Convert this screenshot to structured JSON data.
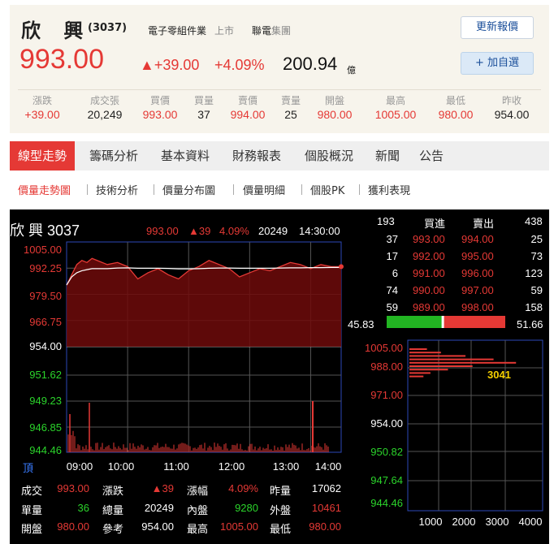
{
  "header": {
    "name": "欣 興",
    "code": "(3037)",
    "industry": "電子零組件業",
    "market": "上市",
    "group_a": "聯電",
    "group_b": "集團",
    "refresh_label": "更新報價",
    "add_label": "+ 加自選",
    "price": "993.00",
    "change": "▲+39.00",
    "change_pct": "+4.09%",
    "amount": "200.94",
    "amount_unit": "億",
    "stats": [
      {
        "label": "漲跌",
        "value": "+39.00"
      },
      {
        "label": "成交張",
        "value": "20,249"
      },
      {
        "label": "買價",
        "value": "993.00"
      },
      {
        "label": "買量",
        "value": "37"
      },
      {
        "label": "賣價",
        "value": "994.00"
      },
      {
        "label": "賣量",
        "value": "25"
      },
      {
        "label": "開盤",
        "value": "980.00"
      },
      {
        "label": "最高",
        "value": "1005.00"
      },
      {
        "label": "最低",
        "value": "980.00"
      },
      {
        "label": "昨收",
        "value": "954.00"
      }
    ]
  },
  "tabs": [
    "線型走勢",
    "籌碼分析",
    "基本資料",
    "財務報表",
    "個股概況",
    "新聞",
    "公告"
  ],
  "subtabs": [
    "價量走勢圖",
    "技術分析",
    "價量分布圖",
    "價量明細",
    "個股PK",
    "獲利表現"
  ],
  "chart": {
    "title": "欣 興 3037",
    "last_price": "993.00",
    "last_change": "▲39",
    "last_pct": "4.09%",
    "last_volume": "20249",
    "last_time": "14:30:00",
    "top_label": "頂"
  },
  "order_book": {
    "header": {
      "total_bid": "193",
      "bid": "買進",
      "ask": "賣出",
      "total_ask": "438"
    },
    "rows": [
      {
        "bid_vol": "37",
        "bid": "993.00",
        "ask": "994.00",
        "ask_vol": "25"
      },
      {
        "bid_vol": "17",
        "bid": "992.00",
        "ask": "995.00",
        "ask_vol": "73"
      },
      {
        "bid_vol": "6",
        "bid": "991.00",
        "ask": "996.00",
        "ask_vol": "123"
      },
      {
        "bid_vol": "74",
        "bid": "990.00",
        "ask": "997.00",
        "ask_vol": "59"
      },
      {
        "bid_vol": "59",
        "bid": "989.00",
        "ask": "998.00",
        "ask_vol": "158"
      }
    ],
    "ratio_left": "45.83",
    "ratio_right": "51.66",
    "ratio_fraction": 0.47
  },
  "summary": [
    [
      {
        "l": "成交",
        "v": "993.00"
      },
      {
        "l": "漲跌",
        "v": "▲39"
      },
      {
        "l": "漲幅",
        "v": "4.09%"
      },
      {
        "l": "昨量",
        "v": "17062"
      }
    ],
    [
      {
        "l": "單量",
        "v": "36"
      },
      {
        "l": "總量",
        "v": "20249"
      },
      {
        "l": "內盤",
        "v": "9280"
      },
      {
        "l": "外盤",
        "v": "10461"
      }
    ],
    [
      {
        "l": "開盤",
        "v": "980.00"
      },
      {
        "l": "參考",
        "v": "954.00"
      },
      {
        "l": "最高",
        "v": "1005.00"
      },
      {
        "l": "最低",
        "v": "980.00"
      }
    ]
  ],
  "chart_data": [
    {
      "type": "line",
      "yticks": [
        "1005.00",
        "992.25",
        "979.50",
        "966.75",
        "954.00",
        "951.62",
        "949.23",
        "946.85",
        "944.46"
      ],
      "xticks": [
        "09:00",
        "10:00",
        "11:00",
        "12:00",
        "13:00",
        "14:00"
      ],
      "ylim": [
        954.0,
        1005.0
      ],
      "reference": 954.0,
      "x_minutes": [
        0,
        5,
        10,
        15,
        20,
        25,
        30,
        40,
        50,
        60,
        70,
        80,
        90,
        100,
        110,
        120,
        130,
        140,
        150,
        160,
        170,
        180,
        190,
        200,
        210,
        220,
        230,
        240,
        250,
        260,
        270
      ],
      "price": [
        984,
        989,
        994,
        996,
        995,
        997,
        996,
        994,
        995,
        993,
        987,
        990,
        992,
        989,
        987,
        991,
        993,
        996,
        994,
        992,
        988,
        990,
        992,
        991,
        993,
        995,
        994,
        992,
        994,
        993,
        993
      ],
      "average": [
        984,
        988,
        990,
        991,
        991.5,
        992,
        992,
        992,
        992.3,
        992.4,
        992.2,
        992.2,
        992.2,
        992.1,
        991.9,
        991.9,
        992,
        992.2,
        992.3,
        992.3,
        992.2,
        992.2,
        992.2,
        992.2,
        992.3,
        992.4,
        992.4,
        992.5,
        992.5,
        992.6,
        992.6
      ]
    },
    {
      "type": "bar",
      "yticks": [
        "1005.00",
        "988.00",
        "971.00",
        "954.00",
        "950.82",
        "947.64",
        "944.46"
      ],
      "xticks": [
        "1000",
        "2000",
        "3000",
        "4000"
      ],
      "xlim": [
        0,
        4000
      ],
      "callout": "3041",
      "prices": [
        1005,
        1002,
        999,
        996,
        993,
        990,
        987,
        984,
        981
      ],
      "volumes": [
        500,
        900,
        1600,
        2400,
        3041,
        1800,
        1100,
        600,
        400
      ]
    }
  ]
}
